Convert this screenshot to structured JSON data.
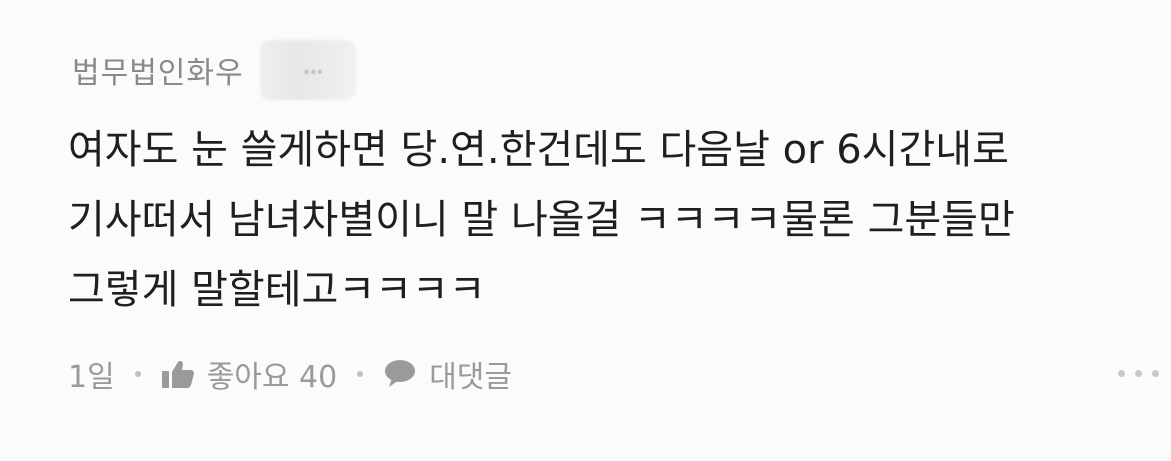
{
  "comment": {
    "author": "법무법인화우",
    "avatar_menu_icon": "more-horizontal-icon",
    "body_lines": [
      "여자도 눈 쓸게하면 당.연.한건데도 다음날 or 6시간내로",
      "기사떠서 남녀차별이니 말 나올걸 ㅋㅋㅋㅋ물론 그분들만",
      "그렇게 말할테고ㅋㅋㅋㅋ"
    ],
    "meta": {
      "time": "1일",
      "like_icon": "thumbs-up-icon",
      "like_label": "좋아요 40",
      "reply_icon": "speech-bubble-icon",
      "reply_label": "대댓글"
    },
    "overflow_icon": "more-horizontal-icon"
  },
  "colors": {
    "background": "#fbfbfb",
    "text": "#1f1f1f",
    "muted": "#9a9a9a"
  }
}
